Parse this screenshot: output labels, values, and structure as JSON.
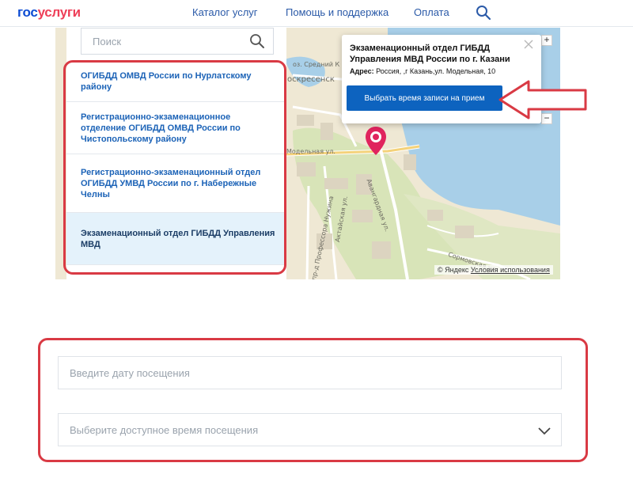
{
  "header": {
    "logo_part1": "гос",
    "logo_part2": "услуги",
    "nav": [
      "Каталог услуг",
      "Помощь и поддержка",
      "Оплата"
    ]
  },
  "search": {
    "placeholder": "Поиск"
  },
  "offices": [
    {
      "label": "ОГИБДД ОМВД России по Нурлатскому району",
      "active": false
    },
    {
      "label": "Регистрационно-экзаменационное отделение ОГИБДД ОМВД России по Чистопольскому району",
      "active": false
    },
    {
      "label": "Регистрационно-экзаменационный отдел ОГИБДД УМВД России по г. Набережные Челны",
      "active": false
    },
    {
      "label": "Экзаменационный отдел ГИБДД Управления МВД",
      "active": true
    }
  ],
  "popup": {
    "title": "Экзаменационный отдел ГИБДД Управления МВД России по г. Казани",
    "address_label": "Адрес:",
    "address_value": "Россия, ,г Казань,ул. Модельная, 10",
    "button": "Выбрать время записи на прием"
  },
  "map": {
    "labels": {
      "sredniy": "оз. Средний К",
      "voskresensk": "оскресенск",
      "modelnaya": "Модельная ул.",
      "avangardnaya": "Авангардная ул.",
      "aktaiskaya": "Актайская ул.",
      "nuzhina": "пр-д Профессора Нужина",
      "sormovskaya": "Сормовская ул."
    },
    "zoom_in": "+",
    "zoom_out": "−",
    "copyright": "© Яндекс",
    "terms": "Условия использования"
  },
  "form": {
    "date_placeholder": "Введите дату посещения",
    "time_placeholder": "Выберите доступное время посещения"
  },
  "colors": {
    "brand_blue": "#0d4cd3",
    "brand_red": "#ee3f58",
    "link_blue": "#1c63b7",
    "button_blue": "#0d63bf",
    "annotation_red": "#d93a44",
    "active_item_bg": "#e4f2fb"
  }
}
